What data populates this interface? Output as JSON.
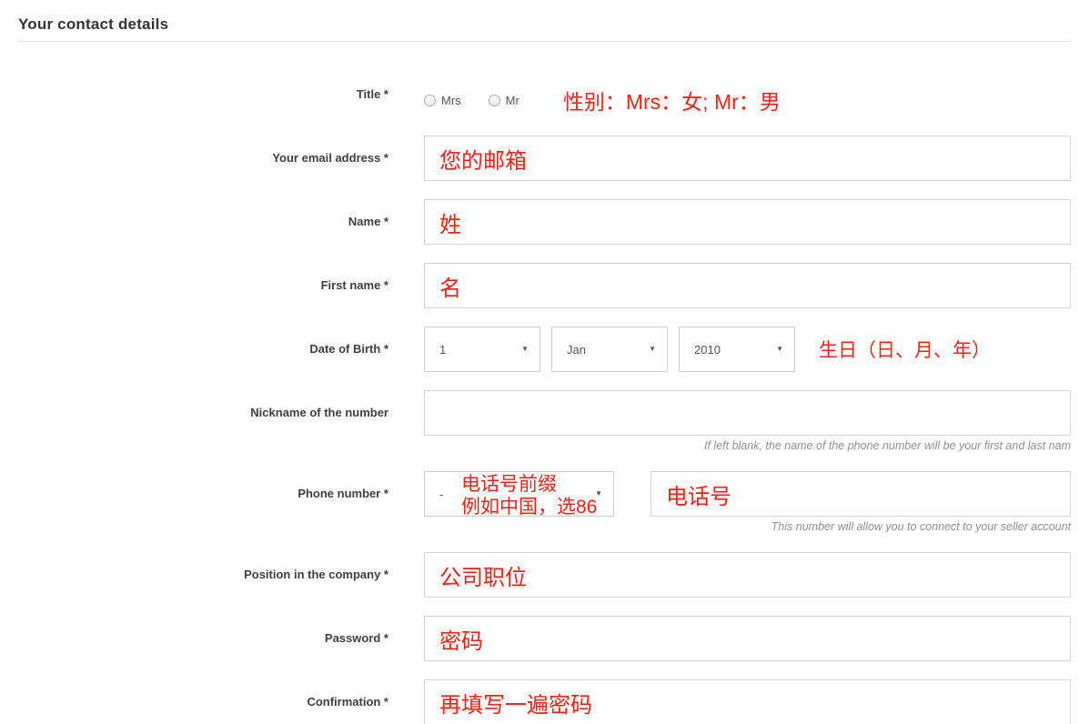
{
  "header": {
    "title": "Your contact details"
  },
  "colors": {
    "annotation_red": "#ff1e14",
    "label_gray": "#3f3f3f",
    "border_gray": "#d5d5d5"
  },
  "form": {
    "title_field": {
      "label": "Title *",
      "options": [
        "Mrs",
        "Mr"
      ],
      "annotation": "性别：Mrs：女; Mr：男"
    },
    "email": {
      "label": "Your email address *",
      "value": "您的邮箱"
    },
    "name": {
      "label": "Name *",
      "value": "姓"
    },
    "first_name": {
      "label": "First name *",
      "value": "名"
    },
    "dob": {
      "label": "Date of Birth *",
      "day": "1",
      "month": "Jan",
      "year": "2010",
      "annotation": "生日（日、月、年）"
    },
    "nickname": {
      "label": "Nickname of the number",
      "value": "",
      "helper": "If left blank, the name of the phone number will be your first and last nam"
    },
    "phone": {
      "label": "Phone number *",
      "prefix_value": "-",
      "annotation_line1": "电话号前缀",
      "annotation_line2": "例如中国，选86",
      "value": "电话号",
      "helper": "This number will allow you to connect to your seller account"
    },
    "position": {
      "label": "Position in the company *",
      "value": "公司职位"
    },
    "password": {
      "label": "Password *",
      "value": "密码"
    },
    "confirmation": {
      "label": "Confirmation *",
      "value": "再填写一遍密码"
    }
  },
  "icons": {
    "select_arrow": "▼"
  }
}
